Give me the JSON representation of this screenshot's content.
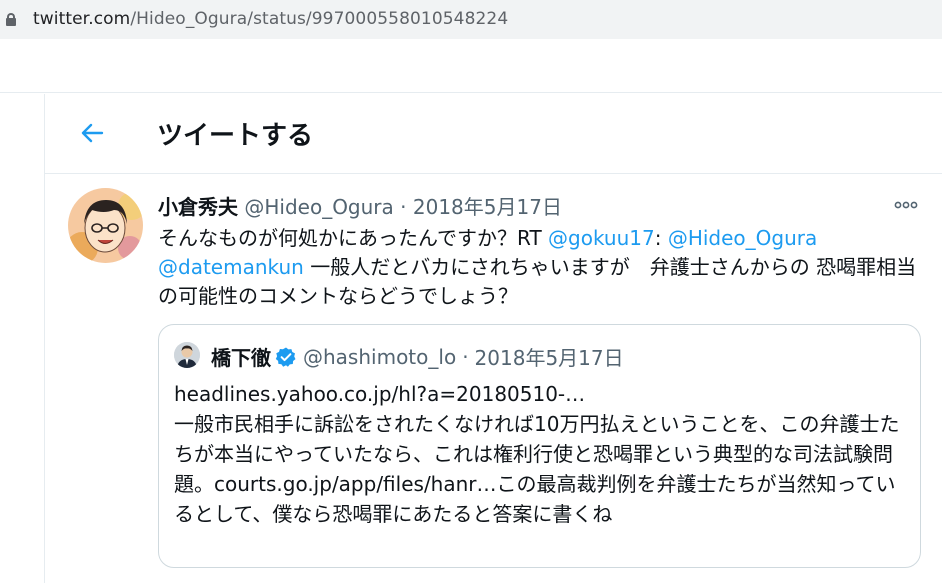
{
  "browser": {
    "url_host": "twitter.com",
    "url_path": "/Hideo_Ogura/status/997000558010548224"
  },
  "header": {
    "title": "ツイートする"
  },
  "tweet": {
    "name": "小倉秀夫",
    "handle": "@Hideo_Ogura",
    "separator": "·",
    "date": "2018年5月17日",
    "text_1": "そんなものが何処かにあったんですか？RT ",
    "mention_1": "@gokuu17",
    "text_2": ": ",
    "mention_2": "@Hideo_Ogura",
    "text_3": " ",
    "mention_3": "@datemankun",
    "text_4": " 一般人だとバカにされちゃいますが　弁護士さんからの 恐喝罪相当の可能性のコメントならどうでしょう？"
  },
  "quote": {
    "name": "橋下徹",
    "handle": "@hashimoto_lo",
    "separator": "·",
    "date": "2018年5月17日",
    "line_1": "headlines.yahoo.co.jp/hl?a=20180510-…",
    "line_2": "一般市民相手に訴訟をされたくなければ10万円払えということを、この弁護士たちが本当にやっていたなら、これは権利行使と恐喝罪という典型的な司法試験問題。courts.go.jp/app/files/hanr…この最高裁判例を弁護士たちが当然知っているとして、僕なら恐喝罪にあたると答案に書くね"
  },
  "colors": {
    "accent": "#1d9bf0",
    "text": "#0f1419",
    "secondary": "#536471"
  }
}
